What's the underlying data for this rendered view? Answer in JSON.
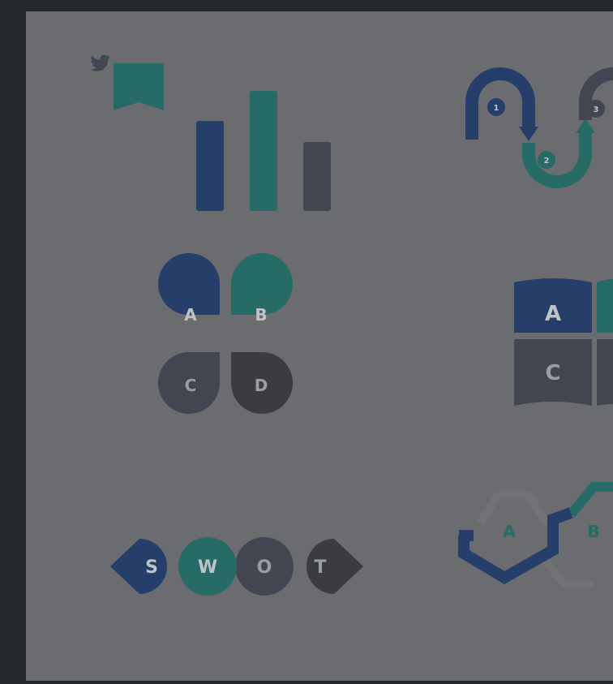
{
  "colors": {
    "outer_background": "#25282d",
    "panel_background": "#6b6c6f",
    "navy": "#263f6a",
    "teal": "#276b66",
    "slate": "#414650",
    "charcoal": "#3b3c3f",
    "label_light": "#bfc3c8",
    "label_dark": "#9a9ea4"
  },
  "icons": {
    "twitter_ribbon": "twitter-bird-icon"
  },
  "bar_chart": {
    "values": [
      3,
      4,
      2.3
    ],
    "colors": [
      "navy",
      "teal",
      "slate"
    ]
  },
  "steps": {
    "labels": [
      "1",
      "2",
      "3"
    ]
  },
  "quad_bubbles": {
    "labels": [
      "A",
      "B",
      "C",
      "D"
    ]
  },
  "book_grid": {
    "labels": [
      "A",
      "C"
    ]
  },
  "swot": {
    "labels": [
      "S",
      "W",
      "O",
      "T"
    ]
  },
  "hex_steps": {
    "labels": [
      "A",
      "B"
    ]
  }
}
